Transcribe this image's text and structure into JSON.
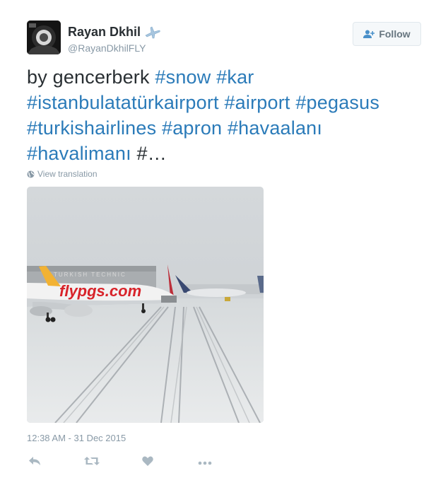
{
  "user": {
    "display_name": "Rayan Dkhil",
    "handle": "@RayanDkhilFLY"
  },
  "follow_button": {
    "label": "Follow"
  },
  "tweet": {
    "segments": [
      {
        "text": "by gencerberk ",
        "type": "plain"
      },
      {
        "text": "#snow",
        "type": "hashtag"
      },
      {
        "text": " ",
        "type": "plain"
      },
      {
        "text": "#kar",
        "type": "hashtag"
      },
      {
        "text": " ",
        "type": "plain"
      },
      {
        "text": "#istanbulatatürkairport",
        "type": "hashtag"
      },
      {
        "text": " ",
        "type": "plain"
      },
      {
        "text": "#airport",
        "type": "hashtag"
      },
      {
        "text": " ",
        "type": "plain"
      },
      {
        "text": "#pegasus",
        "type": "hashtag"
      },
      {
        "text": " ",
        "type": "plain"
      },
      {
        "text": "#turkishairlines",
        "type": "hashtag"
      },
      {
        "text": " ",
        "type": "plain"
      },
      {
        "text": "#apron",
        "type": "hashtag"
      },
      {
        "text": " ",
        "type": "plain"
      },
      {
        "text": "#havaalanı",
        "type": "hashtag"
      },
      {
        "text": " ",
        "type": "plain"
      },
      {
        "text": "#havalimanı",
        "type": "hashtag"
      },
      {
        "text": " #…",
        "type": "plain"
      }
    ]
  },
  "translate": {
    "label": "View translation"
  },
  "photo": {
    "aircraft_livery_text": "flypgs.com",
    "hangar_text": "TURKISH TECHNIC"
  },
  "timestamp": "12:38 AM - 31 Dec 2015",
  "icons": {
    "reply": "reply-icon",
    "retweet": "retweet-icon",
    "like": "heart-icon",
    "more": "more-icon",
    "plane": "airplane-icon",
    "globe": "globe-icon",
    "follow": "add-user-icon"
  },
  "colors": {
    "text": "#292f33",
    "link": "#2b7bb9",
    "muted": "#8899a6",
    "action": "#aab8c2",
    "pegasus_yellow": "#f2b233",
    "pegasus_red": "#d8232a"
  }
}
